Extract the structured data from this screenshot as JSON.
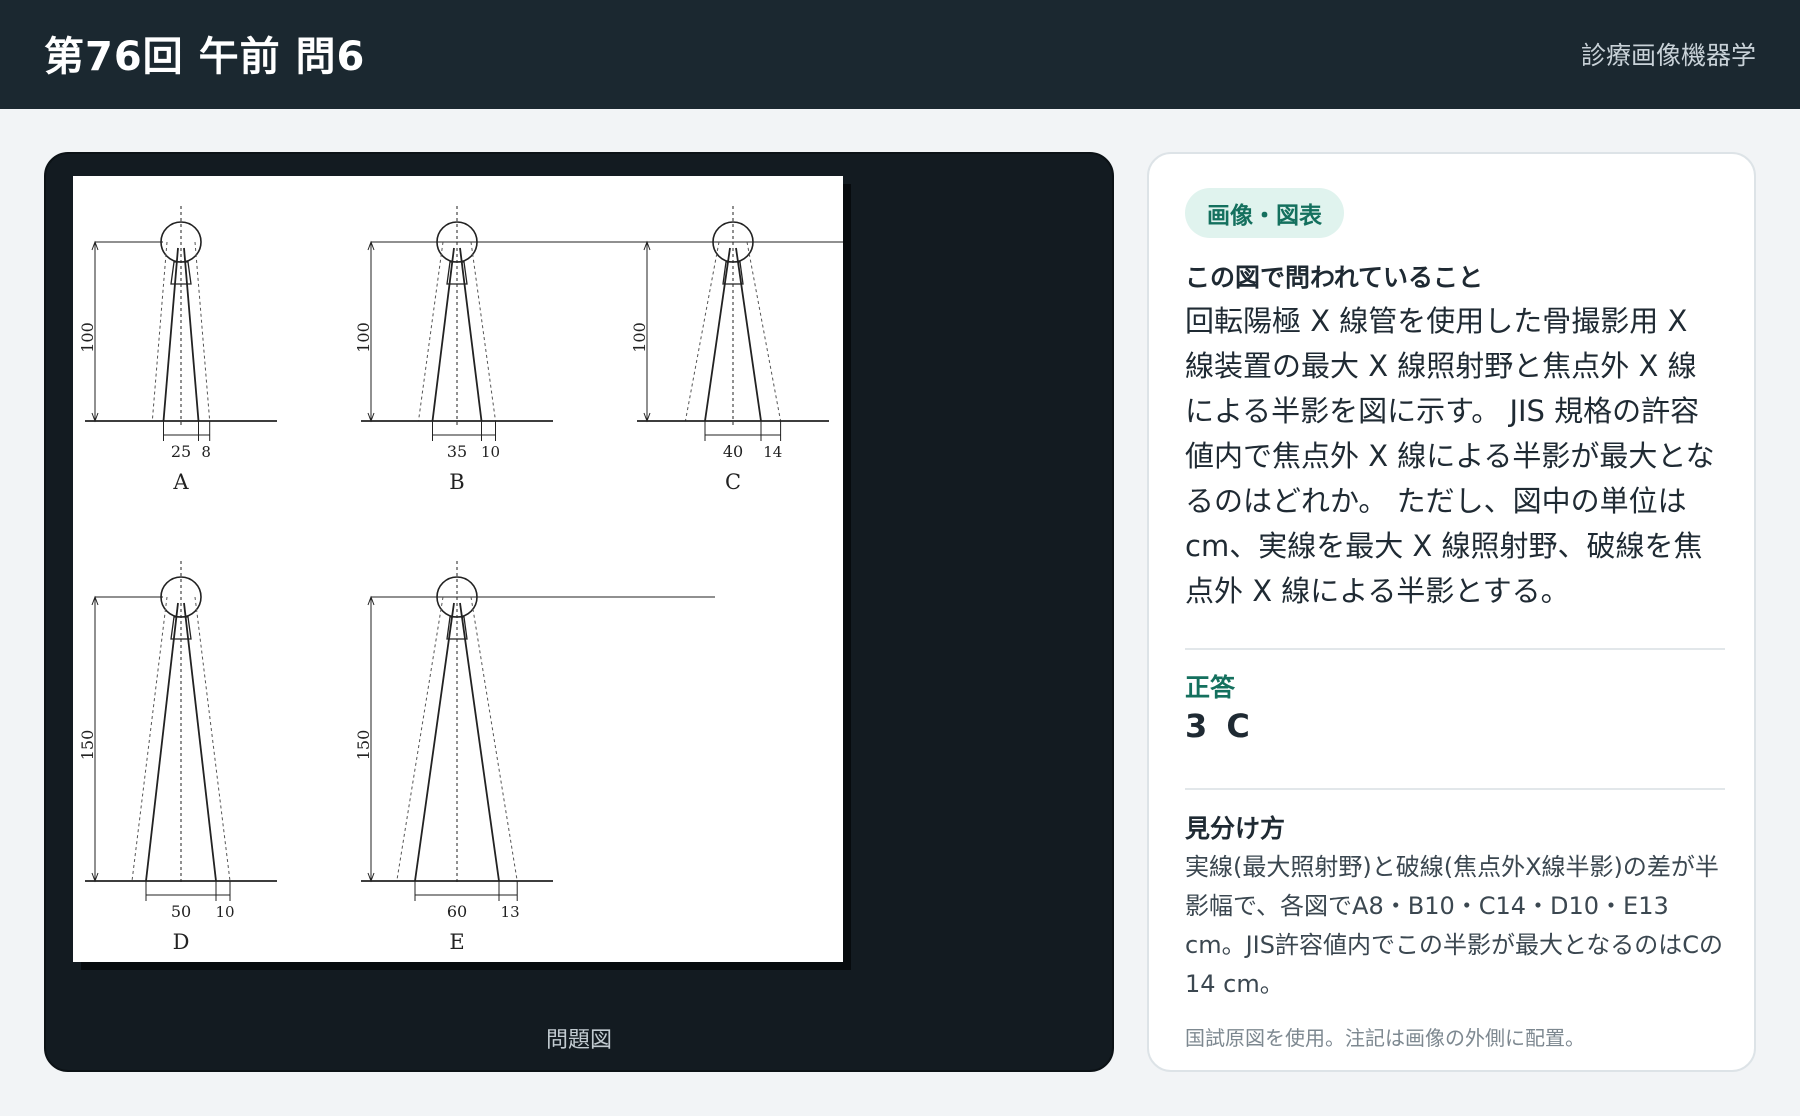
{
  "header": {
    "title": "第76回 午前 問6",
    "subject": "診療画像機器学"
  },
  "figure": {
    "caption": "問題図",
    "panels": [
      {
        "id": "A",
        "height": "100",
        "field": "25",
        "penumbra": "8"
      },
      {
        "id": "B",
        "height": "100",
        "field": "35",
        "penumbra": "10"
      },
      {
        "id": "C",
        "height": "100",
        "field": "40",
        "penumbra": "14"
      },
      {
        "id": "D",
        "height": "150",
        "field": "50",
        "penumbra": "10"
      },
      {
        "id": "E",
        "height": "150",
        "field": "60",
        "penumbra": "13"
      }
    ]
  },
  "card": {
    "badge": "画像・図表",
    "question_label": "この図で問われていること",
    "question_text": "回転陽極 X 線管を使用した骨撮影用 X 線装置の最大 X 線照射野と焦点外 X 線による半影を図に示す。 JIS 規格の許容値内で焦点外 X 線による半影が最大となるのはどれか。 ただし、図中の単位は cm、実線を最大 X 線照射野、破線を焦点外 X 線による半影とする。",
    "answer_label": "正答",
    "answer_value": "3 C",
    "explain_label": "見分け方",
    "explain_text": "実線(最大照射野)と破線(焦点外X線半影)の差が半影幅で、各図でA8・B10・C14・D10・E13 cm。JIS許容値内でこの半影が最大となるのはCの14 cm。",
    "footnote": "国試原図を使用。注記は画像の外側に配置。"
  }
}
